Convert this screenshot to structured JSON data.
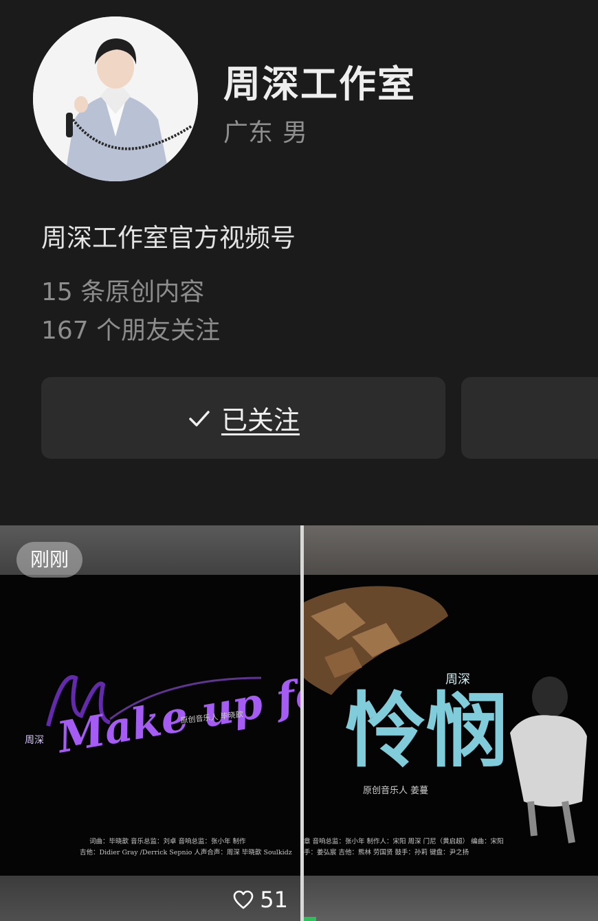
{
  "profile": {
    "name": "周深工作室",
    "region": "广东",
    "gender": "男",
    "bio": "周深工作室官方视频号",
    "original_content": "15 条原创内容",
    "friends_following": "167 个朋友关注"
  },
  "actions": {
    "follow_label": "已关注"
  },
  "videos": [
    {
      "badge": "刚刚",
      "title_art": "Make up forever",
      "artist": "周深",
      "subtitle": "原创音乐人 毕晓歆",
      "credits_line1": "词曲：毕晓歆      音乐总监：刘卓      音响总监：张小年      制作",
      "credits_line2": "吉他：Didier Gray /Derrick Sepnio      人声合声：周深 毕晓歆 Soulkidz",
      "likes": "51"
    },
    {
      "title_art": "怜悯",
      "artist": "周深",
      "subtitle": "原创音乐人 姜蔓",
      "credits_line1": "章      音响总监：张小年      制作人：宋阳 周深 门尼（黄启超）      编曲：宋阳",
      "credits_line2": "手：姜弘宸      吉他：熊林 劳国贤      鼓手：孙莉      键盘：尹之扬"
    }
  ],
  "colors": {
    "background": "#1b1b1b",
    "button": "#2c2c2c",
    "accent_purple": "#a45cf2",
    "accent_cyan": "#8fe2f2"
  }
}
